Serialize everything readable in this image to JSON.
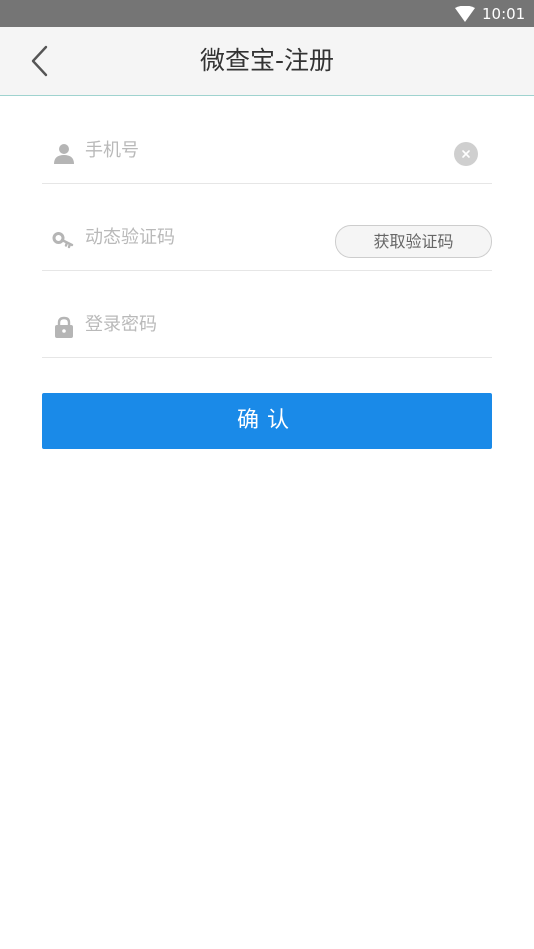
{
  "status_bar": {
    "time": "10:01",
    "wifi_icon": "wifi-icon"
  },
  "header": {
    "title": "微查宝-注册",
    "back_icon": "back-chevron-icon"
  },
  "form": {
    "phone": {
      "placeholder": "手机号",
      "value": "",
      "icon": "person-icon",
      "clear_icon": "clear-icon"
    },
    "sms_code": {
      "placeholder": "动态验证码",
      "value": "",
      "icon": "key-icon",
      "button_label": "获取验证码"
    },
    "password": {
      "placeholder": "登录密码",
      "value": "",
      "icon": "lock-icon"
    }
  },
  "actions": {
    "confirm_label": "确认"
  },
  "colors": {
    "status_bar": "#757575",
    "app_bar": "#f5f5f5",
    "primary": "#1a8ae8",
    "divider": "#e6e6e6",
    "placeholder": "#b9b9b9"
  }
}
